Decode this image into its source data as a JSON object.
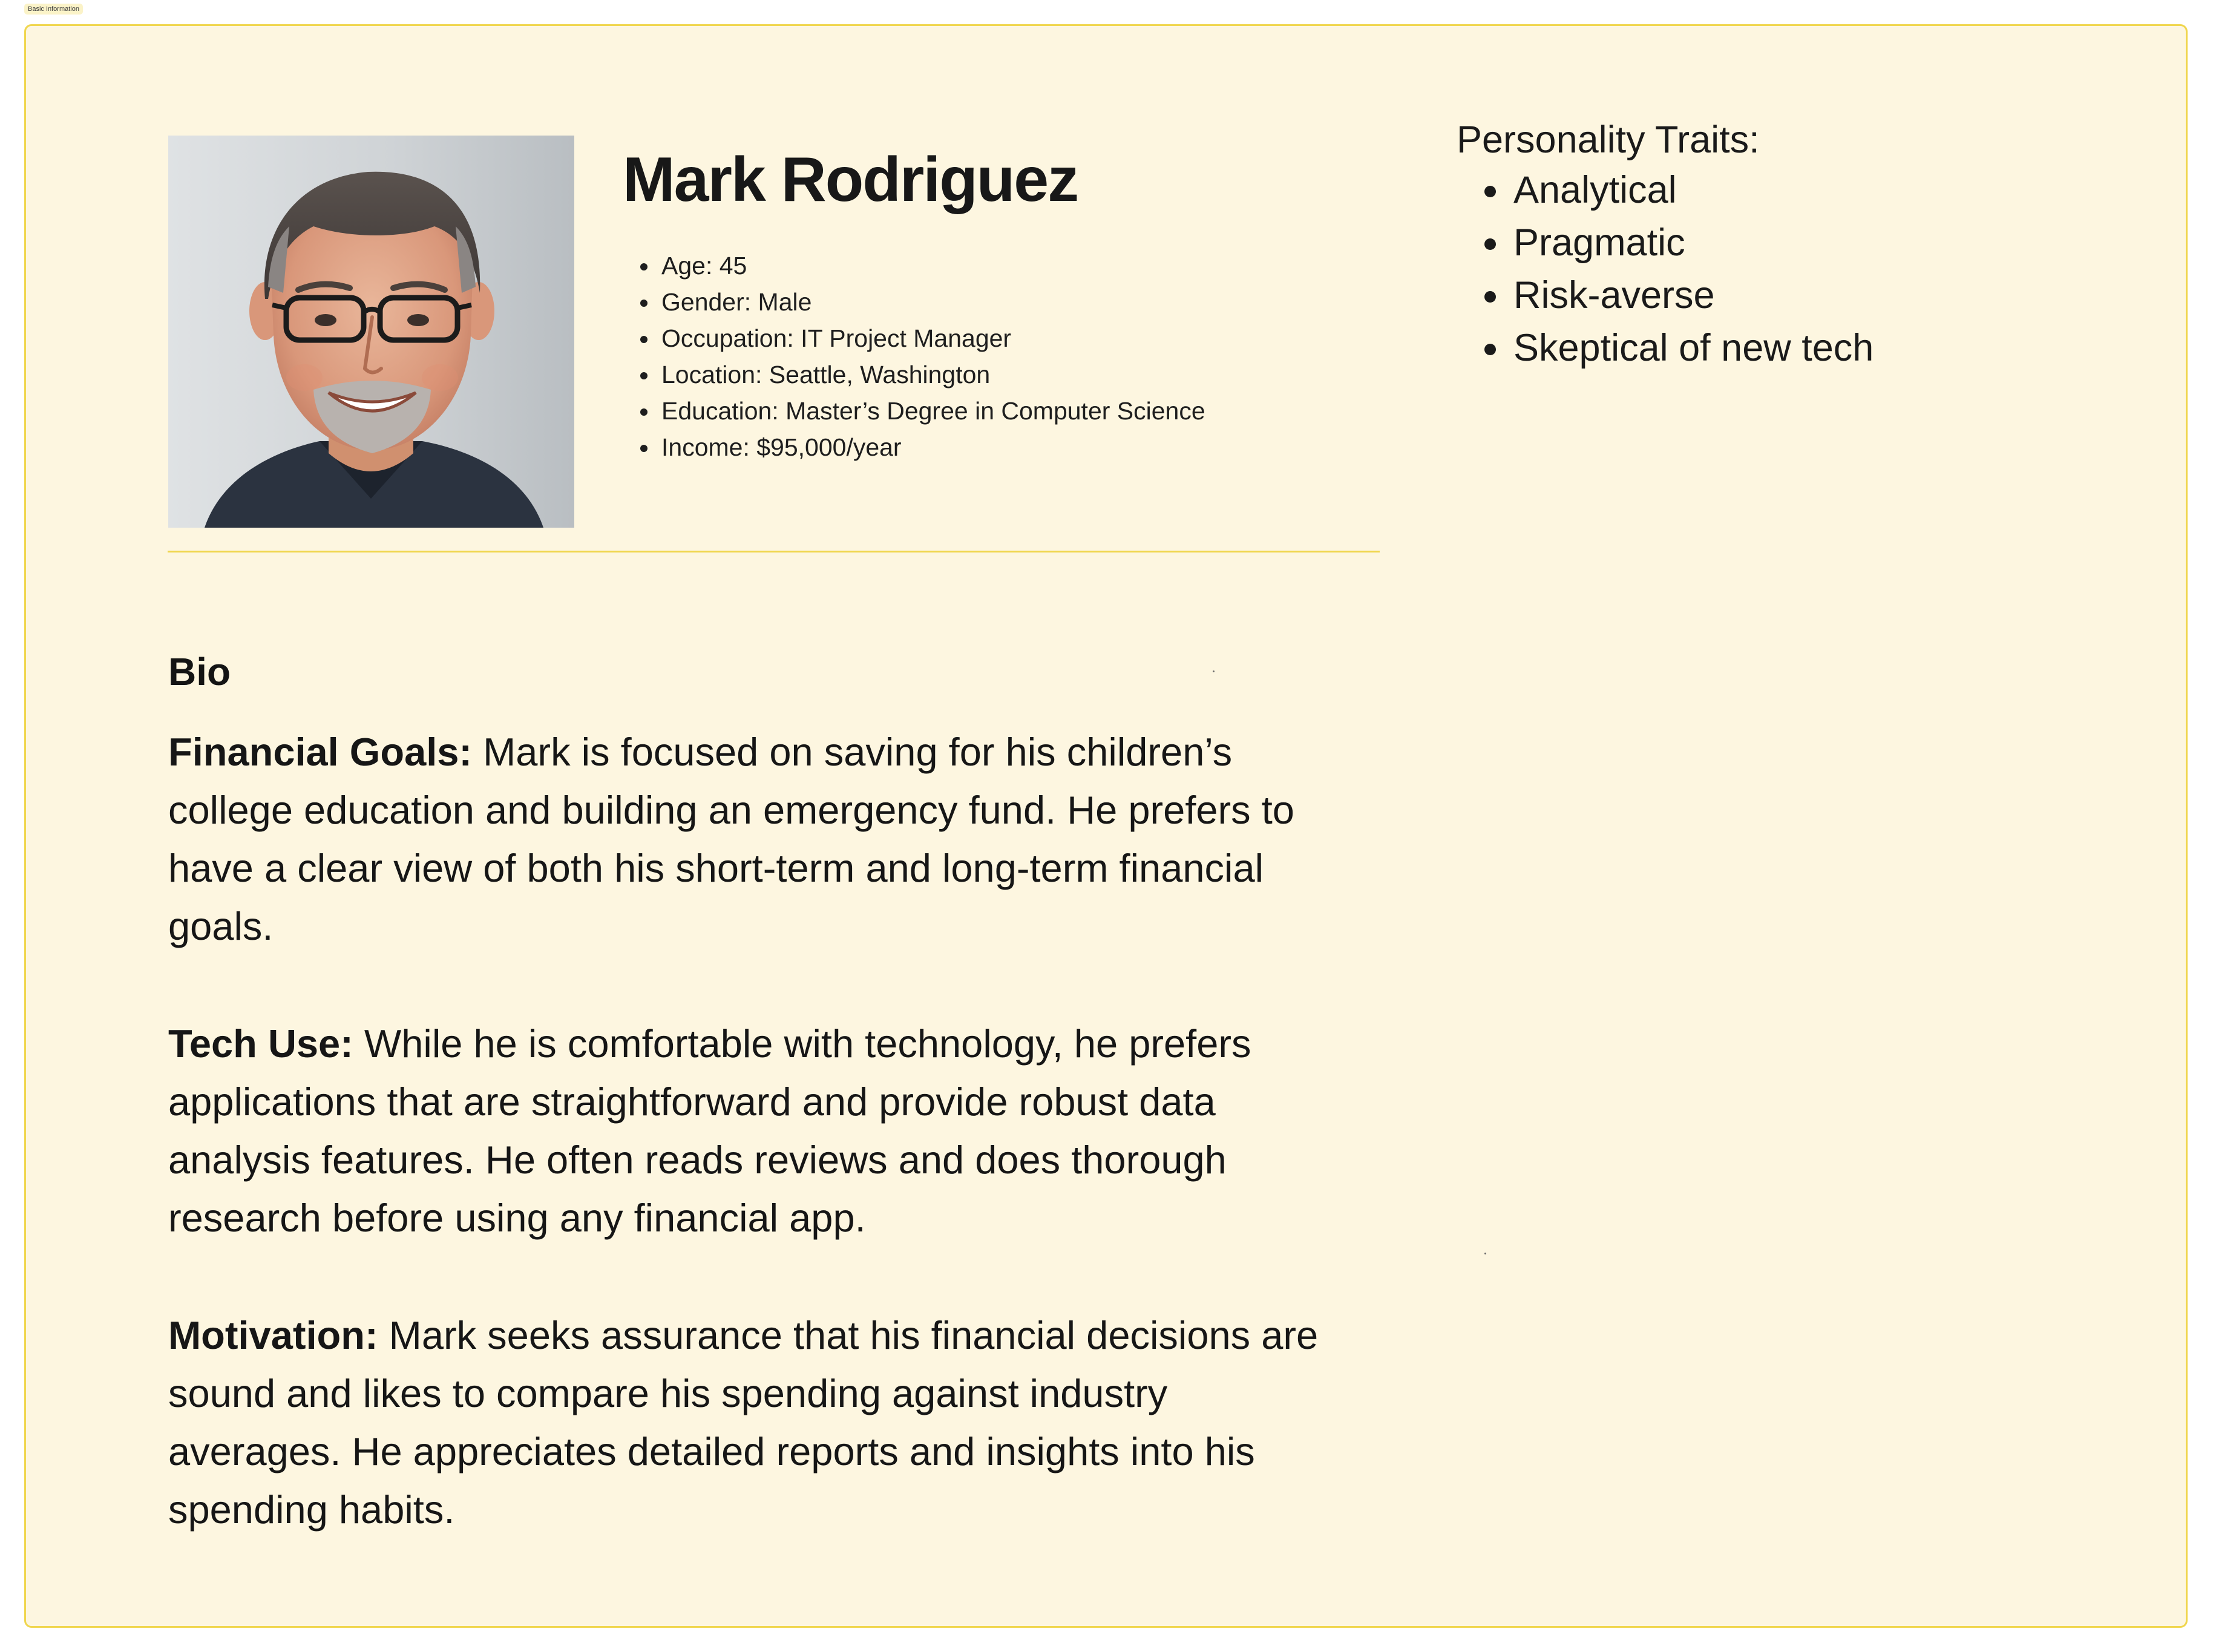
{
  "tag": "Basic Information",
  "persona": {
    "name": "Mark Rodriguez",
    "photo_alt": "Portrait of Mark Rodriguez",
    "details": [
      "Age: 45",
      "Gender: Male",
      "Occupation: IT Project Manager",
      "Location: Seattle, Washington",
      "Education: Master’s Degree in Computer Science",
      "Income: $95,000/year"
    ]
  },
  "traits": {
    "title": "Personality Traits:",
    "items": [
      "Analytical",
      "Pragmatic",
      "Risk-averse",
      "Skeptical of new tech"
    ]
  },
  "bio": {
    "heading": "Bio",
    "sections": [
      {
        "label": "Financial Goals:",
        "text": " Mark is focused on saving for his children’s college education and building an emergency fund. He prefers to have a clear view of both his short-term and long-term financial goals."
      },
      {
        "label": "Tech Use:",
        "text": " While he is comfortable with technology, he prefers applications that are straightforward and provide robust data analysis features. He often reads reviews and does thorough research before using any financial app."
      },
      {
        "label": "Motivation:",
        "text": " Mark seeks assurance that his financial decisions are sound and likes to compare his spending against industry averages. He appreciates detailed reports and insights into his spending habits."
      }
    ]
  },
  "colors": {
    "card_background": "#fdf6e0",
    "card_border": "#f0d64e",
    "tag_background": "#fbf3c8",
    "text": "#161616"
  }
}
